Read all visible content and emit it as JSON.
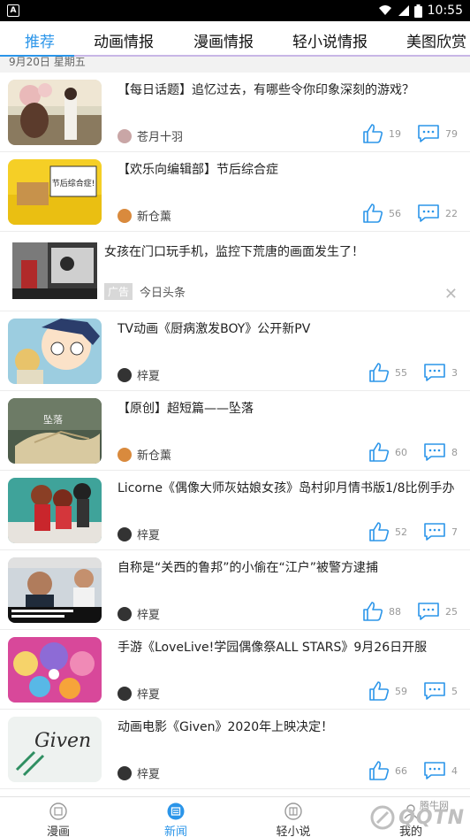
{
  "status_bar": {
    "time": "10:55",
    "left_icon": "A"
  },
  "tabs": [
    {
      "label": "推荐",
      "active": true
    },
    {
      "label": "动画情报",
      "active": false
    },
    {
      "label": "漫画情报",
      "active": false
    },
    {
      "label": "轻小说情报",
      "active": false
    },
    {
      "label": "美图欣赏",
      "active": false
    }
  ],
  "date_strip": "9月20日  星期五",
  "feed": [
    {
      "title": "【每日话题】追忆过去，有哪些令你印象深刻的游戏？",
      "author": "苍月十羽",
      "likes": "19",
      "comments": "79"
    },
    {
      "title": "【欢乐向编辑部】节后综合症",
      "author": "新仓薰",
      "likes": "56",
      "comments": "22",
      "thumb_text": "节后综合症!"
    },
    {
      "title": "女孩在门口玩手机，监控下荒唐的画面发生了！",
      "ad_tag": "广告",
      "source": "今日头条",
      "close": "✕"
    },
    {
      "title": "TV动画《厨病激发BOY》公开新PV",
      "author": "梓夏",
      "likes": "55",
      "comments": "3"
    },
    {
      "title": "【原创】超短篇——坠落",
      "author": "新仓薰",
      "likes": "60",
      "comments": "8",
      "thumb_text": "坠落"
    },
    {
      "title": "Licorne《偶像大师灰姑娘女孩》岛村卯月情书版1/8比例手办",
      "author": "梓夏",
      "likes": "52",
      "comments": "7"
    },
    {
      "title": "自称是“关西的鲁邦”的小偷在“江户”被警方逮捕",
      "author": "梓夏",
      "likes": "88",
      "comments": "25"
    },
    {
      "title": "手游《LoveLive!学园偶像祭ALL STARS》9月26日开服",
      "author": "梓夏",
      "likes": "59",
      "comments": "5"
    },
    {
      "title": "动画电影《Given》2020年上映决定！",
      "author": "梓夏",
      "likes": "66",
      "comments": "4",
      "thumb_text": "Given"
    }
  ],
  "bottom_nav": [
    {
      "label": "漫画",
      "icon": "book-icon",
      "active": false
    },
    {
      "label": "新闻",
      "icon": "news-icon",
      "active": true
    },
    {
      "label": "轻小说",
      "icon": "novel-icon",
      "active": false
    },
    {
      "label": "我的",
      "icon": "user-icon",
      "active": false
    }
  ],
  "watermark": {
    "text": "QQTN",
    "site": "腾牛网"
  },
  "colors": {
    "accent": "#2b95e9",
    "underline": "#c8b6e6"
  }
}
